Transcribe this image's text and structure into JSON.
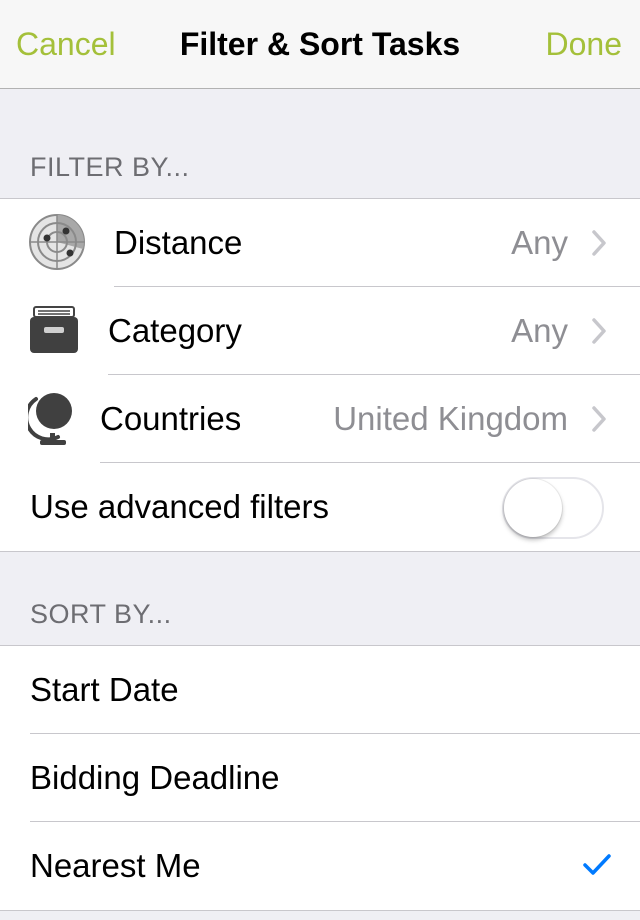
{
  "navbar": {
    "cancel_label": "Cancel",
    "title": "Filter & Sort Tasks",
    "done_label": "Done"
  },
  "filter": {
    "header": "FILTER BY...",
    "items": [
      {
        "label": "Distance",
        "value": "Any",
        "icon": "radar-icon"
      },
      {
        "label": "Category",
        "value": "Any",
        "icon": "archive-box-icon"
      },
      {
        "label": "Countries",
        "value": "United Kingdom",
        "icon": "globe-icon"
      }
    ],
    "advanced": {
      "label": "Use advanced filters",
      "enabled": false
    }
  },
  "sort": {
    "header": "SORT BY...",
    "items": [
      {
        "label": "Start Date",
        "selected": false
      },
      {
        "label": "Bidding Deadline",
        "selected": false
      },
      {
        "label": "Nearest Me",
        "selected": true
      }
    ]
  },
  "colors": {
    "accent": "#a4c03a",
    "checkmark": "#007aff",
    "secondary_text": "#8e8e93",
    "section_bg": "#efeff4"
  }
}
